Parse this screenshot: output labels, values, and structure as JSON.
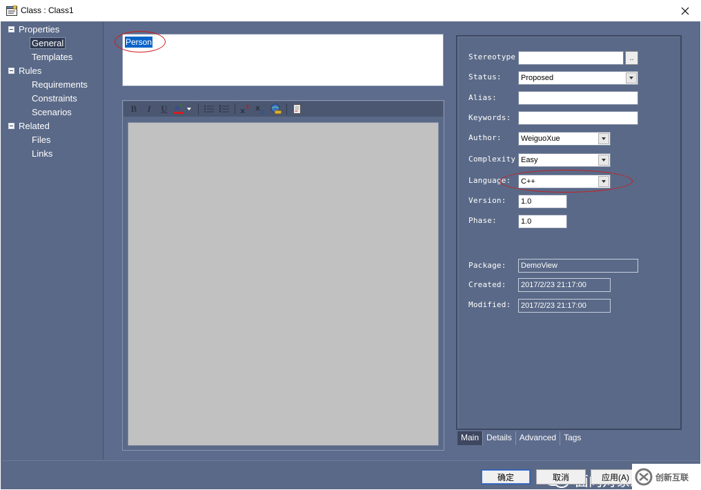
{
  "window": {
    "title": "Class : Class1",
    "close_glyph": "×"
  },
  "tree": {
    "items": [
      {
        "label": "Properties",
        "level": 0,
        "expander": true
      },
      {
        "label": "General",
        "level": 1,
        "selected": true
      },
      {
        "label": "Templates",
        "level": 1
      },
      {
        "label": "Rules",
        "level": 0,
        "expander": true
      },
      {
        "label": "Requirements",
        "level": 1
      },
      {
        "label": "Constraints",
        "level": 1
      },
      {
        "label": "Scenarios",
        "level": 1
      },
      {
        "label": "Related",
        "level": 0,
        "expander": true
      },
      {
        "label": "Files",
        "level": 1
      },
      {
        "label": "Links",
        "level": 1
      }
    ]
  },
  "name": {
    "value": "Person"
  },
  "toolbar": {
    "bold": "B",
    "italic": "I",
    "underline": "U",
    "icons": [
      "bold-icon",
      "italic-icon",
      "underline-icon",
      "font-color-icon",
      "bullet-list-icon",
      "numbered-list-icon",
      "superscript-icon",
      "subscript-icon",
      "hyperlink-icon",
      "document-icon"
    ]
  },
  "fields": {
    "stereotype": {
      "label": "Stereotype",
      "value": ""
    },
    "stereotype_button": "..",
    "status": {
      "label": "Status:",
      "value": "Proposed"
    },
    "alias": {
      "label": "Alias:",
      "value": ""
    },
    "keywords": {
      "label": "Keywords:",
      "value": ""
    },
    "author": {
      "label": "Author:",
      "value": "WeiguoXue"
    },
    "complexity": {
      "label": "Complexity",
      "value": "Easy"
    },
    "language": {
      "label": "Language:",
      "value": "C++"
    },
    "version": {
      "label": "Version:",
      "value": "1.0"
    },
    "phase": {
      "label": "Phase:",
      "value": "1.0"
    },
    "package": {
      "label": "Package:",
      "value": "DemoView"
    },
    "created": {
      "label": "Created:",
      "value": "2017/2/23 21:17:00"
    },
    "modified": {
      "label": "Modified:",
      "value": "2017/2/23 21:17:00"
    }
  },
  "tabs": [
    "Main",
    "Details",
    "Advanced",
    "Tags"
  ],
  "buttons": {
    "ok": "确定",
    "cancel": "取消",
    "apply": "应用(A)"
  },
  "watermark": {
    "text": "面向对象思考",
    "brand": "创新互联"
  },
  "colors": {
    "background": "#5d6b8c",
    "panel": "#5a6987",
    "selection": "#0a64c8",
    "highlight_ellipse": "#d11a1a",
    "editor_area": "#c1c1c1"
  }
}
